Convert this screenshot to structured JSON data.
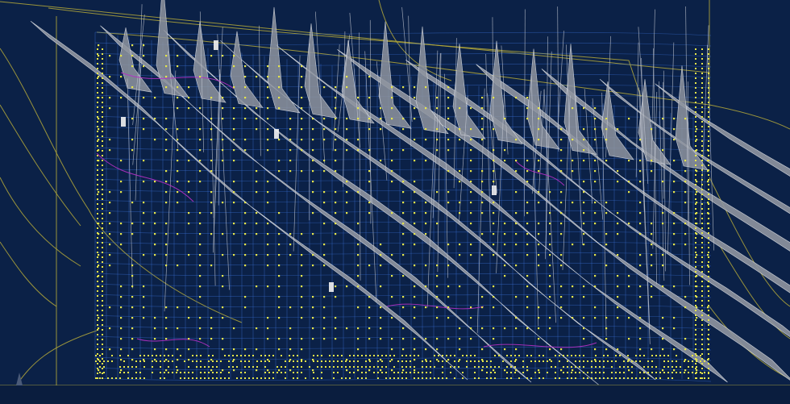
{
  "viewport": {
    "title": "",
    "colors": {
      "background": "#0b2147",
      "surface_fill": "#8f95a0",
      "surface_edge": "#e6e8ec",
      "grid_line": "#3a6fd6",
      "node_point": "#e6e64a",
      "guide_curve": "#b4a83a",
      "accent_curve": "#b530c4",
      "highlight": "#f2f2f2",
      "bottom_bar": "#0a1d3e"
    },
    "icons": [
      "axis-origin-icon"
    ]
  }
}
